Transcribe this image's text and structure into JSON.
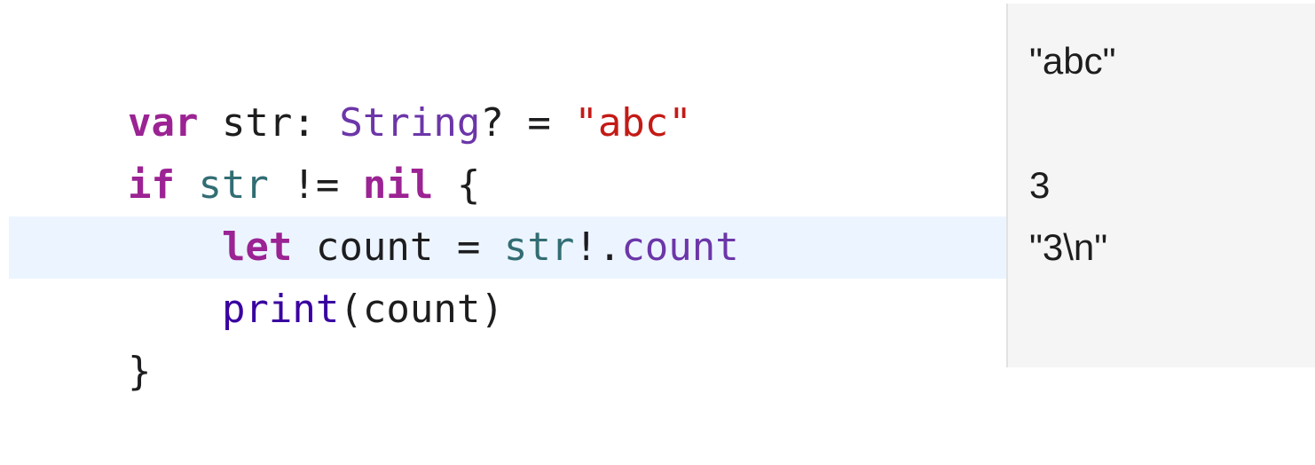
{
  "editor": {
    "lines": [
      {
        "tokens": [
          {
            "text": "var",
            "kind": "keyword"
          },
          {
            "text": " str: ",
            "kind": "plain"
          },
          {
            "text": "String",
            "kind": "type"
          },
          {
            "text": "? = ",
            "kind": "plain"
          },
          {
            "text": "\"abc\"",
            "kind": "string"
          }
        ]
      },
      {
        "tokens": [
          {
            "text": "if",
            "kind": "keyword"
          },
          {
            "text": " ",
            "kind": "plain"
          },
          {
            "text": "str",
            "kind": "variable"
          },
          {
            "text": " != ",
            "kind": "plain"
          },
          {
            "text": "nil",
            "kind": "keyword"
          },
          {
            "text": " {",
            "kind": "plain"
          }
        ]
      },
      {
        "tokens": [
          {
            "text": "    ",
            "kind": "plain"
          },
          {
            "text": "let",
            "kind": "keyword"
          },
          {
            "text": " count = ",
            "kind": "plain"
          },
          {
            "text": "str",
            "kind": "variable"
          },
          {
            "text": "!.",
            "kind": "plain"
          },
          {
            "text": "count",
            "kind": "property"
          }
        ]
      },
      {
        "tokens": [
          {
            "text": "    ",
            "kind": "plain"
          },
          {
            "text": "print",
            "kind": "function"
          },
          {
            "text": "(count)",
            "kind": "plain"
          }
        ]
      },
      {
        "tokens": [
          {
            "text": "}",
            "kind": "plain"
          }
        ]
      }
    ],
    "highlighted_line": 4
  },
  "results": {
    "line1": "\"abc\"",
    "line3": "3",
    "line4": "\"3\\n\""
  },
  "colors": {
    "keyword": "#9b2393",
    "type": "#6c36a9",
    "string": "#c41a16",
    "variable": "#326d74",
    "function": "#3900a0",
    "property": "#6c36a9",
    "highlight": "#ecf5ff",
    "results_background": "#f5f5f5"
  }
}
